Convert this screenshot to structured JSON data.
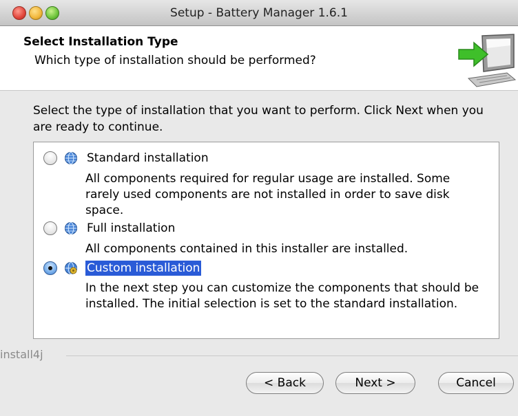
{
  "window": {
    "title": "Setup - Battery Manager 1.6.1"
  },
  "header": {
    "title": "Select Installation Type",
    "subtitle": "Which type of installation should be performed?",
    "icon": "computer-arrow-icon"
  },
  "intro": "Select the type of installation that you want to perform. Click Next when you are ready to continue.",
  "options": [
    {
      "label": "Standard installation",
      "description": "All components required for regular usage are installed. Some rarely used components are not installed in order to save disk space.",
      "selected": false,
      "icon": "globe-icon"
    },
    {
      "label": "Full installation",
      "description": "All components contained in this installer are installed.",
      "selected": false,
      "icon": "globe-icon"
    },
    {
      "label": "Custom installation",
      "description": "In the next step you can customize the components that should be installed. The initial selection is set to the standard installation.",
      "selected": true,
      "icon": "globe-gear-icon"
    }
  ],
  "footer": {
    "brand": "install4j",
    "back_label": "< Back",
    "next_label": "Next >",
    "cancel_label": "Cancel"
  },
  "colors": {
    "selection": "#2a5bd7",
    "arrow": "#3fbf2a"
  }
}
